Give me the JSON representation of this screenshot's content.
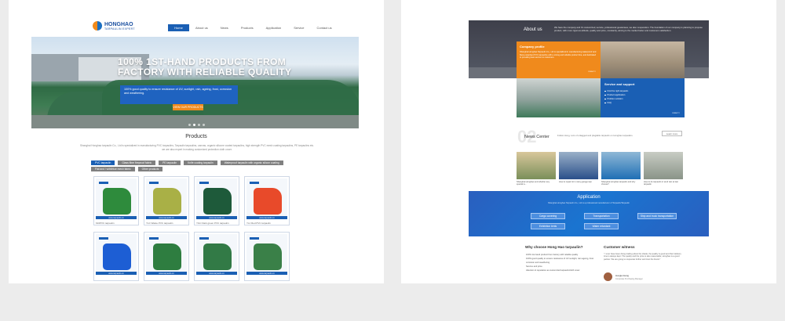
{
  "left_page": {
    "logo": {
      "brand": "HONGHAO",
      "tagline": "TARPAULIN EXPERT"
    },
    "nav": [
      "Home",
      "About us",
      "News",
      "Products",
      "Application",
      "Service",
      "Contact us"
    ],
    "hero": {
      "title_line1": "100% 1ST-HAND PRODUCTS FROM",
      "title_line2": "FACTORY WITH RELIABLE QUALITY",
      "body": "100% good quality to ensure resistance of UV, sunlight, rain, ageing, frost, corrosion and weathering.",
      "button": "VIEW OUR PRODUCTS"
    },
    "products": {
      "title": "Products",
      "description": "Shanghai Honghao tarpaulin Co., Ltd is specialized in manufacturing PVC tarpaulins, Tarpaulin tarpaulins, canvas, organic silicone coated tarpaulins, high strength PVC mesh coating tarpaulins, PE tarpaulins etc. we are also expert in making customized protection cloth cover.",
      "filters": [
        "PVC tarpaulin",
        "Glass fibre fireproof fabric",
        "PE tarpaulin",
        "Knife coating tarpaulin",
        "Waterproof tarpaulin with organic silicon coating",
        "Flat and / with/blue mesh fabric",
        "Other products"
      ],
      "cards": [
        {
          "caption": "610PVC tarpaulin",
          "color": "#2e8b3c"
        },
        {
          "caption": "YLC Waste PVC tarpaulin",
          "color": "#a9b046"
        },
        {
          "caption": "YGC Dark green PVC tarpaulin",
          "color": "#1e5a3a"
        },
        {
          "caption": "YLJ Red PVC tarpaulin",
          "color": "#e84a2a"
        },
        {
          "caption": "",
          "color": "#1d5ed4"
        },
        {
          "caption": "",
          "color": "#2e7d40"
        },
        {
          "caption": "",
          "color": "#327a46"
        },
        {
          "caption": "",
          "color": "#3a8048"
        }
      ],
      "card_bar_text": "www.tarpaulin.cn"
    }
  },
  "right_page": {
    "about": {
      "title": "About us",
      "text": "We have the company and it's customized, service, professional guarantees, we also cooperation. The foundation of our company is planning to propose product, with more rigorous attitude, quality and price, constantly, aiming to the market better and customers satisfaction."
    },
    "company_profile": {
      "title": "Company profile",
      "text": "Shanghai Honghao Tarpaulin Co., Ltd is specialized in manufacturing waterproof and flame-retardant PVC tarpaulins with a strong and reliable product line, and dedicated to providing best service to customers.",
      "more": "more>>"
    },
    "service": {
      "title": "Service and support",
      "items": [
        "Find the right tarpaulin",
        "Product application",
        "Problem solution",
        "FAQ"
      ],
      "more": "more>>"
    },
    "news": {
      "number": "02",
      "title": "News Center",
      "text": "Follow Hong, Lots of unlagged and plagiable tarpaulin on Honghao tarpaulins.",
      "more": "Learn more",
      "items": [
        {
          "caption": "Shanghai Honghao and whether any special is...",
          "c1": "#d8c79b",
          "c2": "#7a8f5a"
        },
        {
          "caption": "How to repair lot in rainy garage tarp",
          "c1": "#9ab0c8",
          "c2": "#2a4f8a"
        },
        {
          "caption": "Shanghai Honghao tarpaulin and why choose?",
          "c1": "#8fb8d6",
          "c2": "#1f6fb5"
        },
        {
          "caption": "How to do tarpaulin in wind rain at last tarpaulin",
          "c1": "#c8ccc4",
          "c2": "#8a9488"
        }
      ]
    },
    "application": {
      "title": "Application",
      "subtitle": "Shanghai Honghao Tarpaulin Co., Ltd is a professional manufacturer of Tarpaulin/Tarpaulin",
      "buttons": [
        "Cargo covering",
        "Transportation",
        "Ship and truck transportation",
        "Exhibition tents",
        "Water retardant"
      ]
    },
    "why": {
      "title": "Why choose Hong Hao tarpaulin?",
      "items": [
        "100% 1st-hand product from factory with reliable quality",
        "100% good quality to ensure resistance of UV sunlight, rain ageing, frost",
        "corrosion and weathering",
        "Service and price",
        "Attention & reputation as customized tarpaulin/cloth cover"
      ]
    },
    "witness": {
      "title": "Customer witness",
      "quote": "\" I ever have been doing trading about the shade, the quality is good and their delivery time is always kept. The quality and the price is also reasonable, Honghao is a good partner. We are going to cooperate further and trust the brand.\"",
      "name": "Honglei Hang",
      "role": "Corporate Purchasing Manager"
    }
  }
}
